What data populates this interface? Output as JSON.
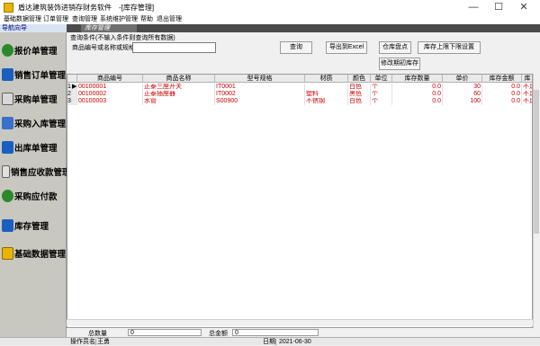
{
  "window": {
    "title": "盾达建筑装饰进销存财务软件　-[库存管理]",
    "min_glyph": "—",
    "max_glyph": "☐",
    "close_glyph": "✕"
  },
  "menu": [
    "基础数据管理",
    "订单管理",
    "查询管理",
    "系统维护管理",
    "帮助",
    "退出管理"
  ],
  "nav": {
    "header": "导航向导",
    "items": [
      {
        "label": "报价单管理",
        "icon": "smiley-icon"
      },
      {
        "label": "销售订单管理",
        "icon": "order-icon"
      },
      {
        "label": "采购单管理",
        "icon": "purchase-icon"
      },
      {
        "label": "采购入库管理",
        "icon": "inbound-icon"
      },
      {
        "label": "出库单管理",
        "icon": "outbound-icon"
      },
      {
        "label": "销售应收款管理",
        "icon": "receivable-icon"
      },
      {
        "label": "采购应付款",
        "icon": "payable-icon"
      },
      {
        "label": "库存管理",
        "icon": "inventory-icon"
      },
      {
        "label": "基础数据管理",
        "icon": "basic-data-icon"
      }
    ]
  },
  "tab": {
    "label": "库存管理"
  },
  "query": {
    "hint": "查询条件(不输入条件则查询所有数据)",
    "search_label": "商品编号或名称或规格",
    "search_value": "",
    "buttons": {
      "query": "查询",
      "export": "导出到Excel",
      "stocktake": "仓库盘点",
      "limit": "库存上限下限设置",
      "initial": "修改期初库存"
    }
  },
  "grid": {
    "columns": [
      "商品编号",
      "商品名称",
      "型号规格",
      "材质",
      "颜色",
      "单位",
      "库存数量",
      "单价",
      "库存金额",
      "库"
    ],
    "rows": [
      {
        "num": "1",
        "marker": "▶",
        "code": "00100001",
        "name": "正泰三座开关",
        "model": "IT0001",
        "material": "",
        "color": "白色",
        "unit": "个",
        "qty": "0.0",
        "price": "30",
        "amount": "0.0",
        "status": "不足"
      },
      {
        "num": "2",
        "marker": "",
        "code": "00100002",
        "name": "正泰插座器",
        "model": "IT0002",
        "material": "塑料",
        "color": "黑色",
        "unit": "个",
        "qty": "0.0",
        "price": "60",
        "amount": "0.0",
        "status": "不足"
      },
      {
        "num": "3",
        "marker": "",
        "code": "00100003",
        "name": "水管",
        "model": "S00900",
        "material": "不锈钢",
        "color": "白色",
        "unit": "个",
        "qty": "0.0",
        "price": "100",
        "amount": "0.0",
        "status": "不足"
      }
    ]
  },
  "footer": {
    "total_qty_label": "总数量",
    "total_qty": "0",
    "total_amount_label": "总金额",
    "total_amount": "0"
  },
  "status": {
    "operator_label": "操作员名",
    "operator": "王勇",
    "date_label": "日期",
    "date": "2021-06-30"
  },
  "colors": {
    "row_text": "#d00000",
    "nav_bg": "#c9c8c0",
    "nav_header_text": "#000080"
  }
}
